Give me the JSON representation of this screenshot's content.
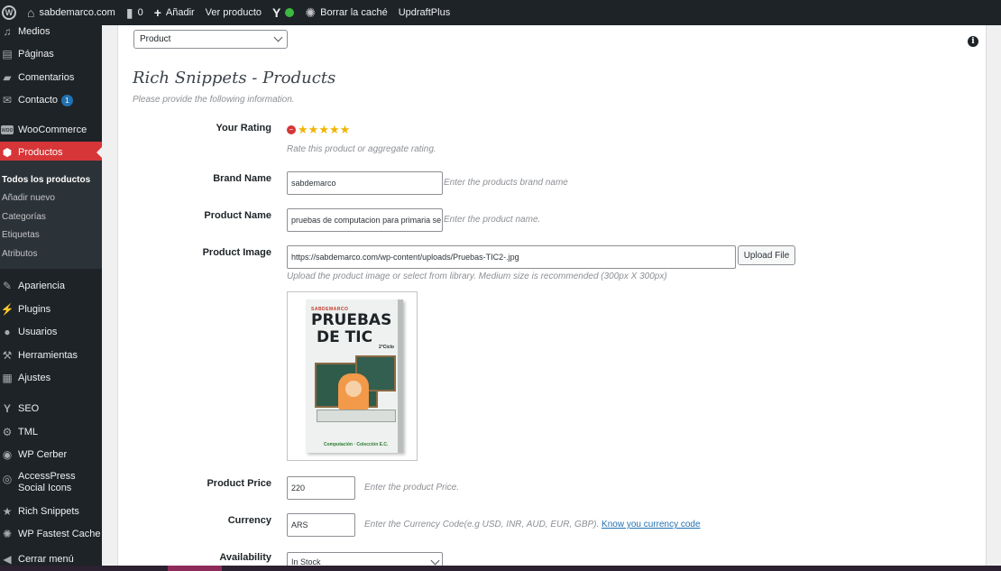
{
  "adminbar": {
    "site_name": "sabdemarco.com",
    "comments_count": "0",
    "add_new": "Añadir",
    "view_product": "Ver producto",
    "clear_cache": "Borrar la caché",
    "updraft": "UpdraftPlus",
    "status_color": "#3db840"
  },
  "sidebar": {
    "items": [
      {
        "label": "Medios",
        "icon": "media-icon"
      },
      {
        "label": "Páginas",
        "icon": "pages-icon"
      },
      {
        "label": "Comentarios",
        "icon": "comments-icon"
      },
      {
        "label": "Contacto",
        "icon": "mail-icon",
        "badge": "1"
      },
      {
        "label": "WooCommerce",
        "icon": "woo-icon"
      },
      {
        "label": "Productos",
        "icon": "products-icon"
      },
      {
        "label": "Apariencia",
        "icon": "appearance-icon"
      },
      {
        "label": "Plugins",
        "icon": "plugins-icon"
      },
      {
        "label": "Usuarios",
        "icon": "users-icon"
      },
      {
        "label": "Herramientas",
        "icon": "tools-icon"
      },
      {
        "label": "Ajustes",
        "icon": "settings-icon"
      },
      {
        "label": "SEO",
        "icon": "yoast-icon"
      },
      {
        "label": "TML",
        "icon": "gear-icon"
      },
      {
        "label": "WP Cerber",
        "icon": "cerber-icon"
      },
      {
        "label": "AccessPress",
        "label2": "Social Icons",
        "icon": "social-icon"
      },
      {
        "label": "Rich Snippets",
        "icon": "star-icon"
      },
      {
        "label": "WP Fastest Cache",
        "icon": "cache-icon"
      },
      {
        "label": "Cerrar menú",
        "icon": "collapse-icon"
      }
    ],
    "submenu": [
      "Todos los productos",
      "Añadir nuevo",
      "Categorías",
      "Etiquetas",
      "Atributos"
    ],
    "active_color": "#d63638"
  },
  "main": {
    "type_select": "Product",
    "title": "Rich Snippets - Products",
    "subtitle": "Please provide the following information.",
    "rating": {
      "label": "Your Rating",
      "stars": 5,
      "hint": "Rate this product or aggregate rating."
    },
    "brand": {
      "label": "Brand Name",
      "value": "sabdemarco",
      "hint": "Enter the products brand name"
    },
    "product_name": {
      "label": "Product Name",
      "value": "pruebas de computacion para primaria se",
      "hint": "Enter the product name."
    },
    "product_image": {
      "label": "Product Image",
      "value": "https://sabdemarco.com/wp-content/uploads/Pruebas-TIC2-.jpg",
      "upload_button": "Upload File",
      "hint": "Upload the product image or select from library. Medium size is recommended (300px X 300px)",
      "cover": {
        "top": "SABDEMARCO",
        "title1": "PRUEBAS",
        "title2": "DE TIC",
        "grade": "2°Ciclo",
        "footer": "Computación · Colección E.C."
      }
    },
    "price": {
      "label": "Product Price",
      "value": "220",
      "hint": "Enter the product Price."
    },
    "currency": {
      "label": "Currency",
      "value": "ARS",
      "hint": "Enter the Currency Code(e.g USD, INR, AUD, EUR, GBP).",
      "link": "Know you currency code"
    },
    "availability": {
      "label": "Availability",
      "value": "In Stock"
    }
  }
}
